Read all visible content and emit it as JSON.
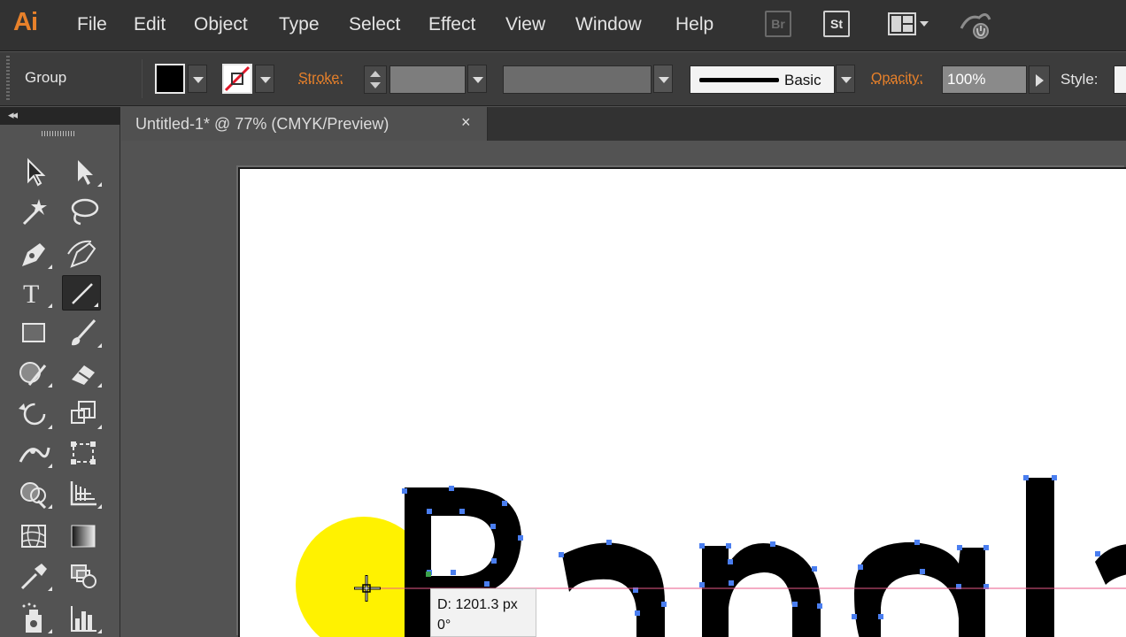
{
  "app": {
    "logo": "Ai"
  },
  "menu": [
    "File",
    "Edit",
    "Object",
    "Type",
    "Select",
    "Effect",
    "View",
    "Window",
    "Help"
  ],
  "menubar_icons": {
    "bridge": "Br",
    "stock": "St",
    "workspace": "workspace-switcher-icon",
    "sync": "sync-settings-icon"
  },
  "control_bar": {
    "selection": "Group",
    "fill_color": "#000000",
    "stroke_color": "none",
    "stroke_label": "Stroke:",
    "brush_label": "Basic",
    "opacity_label": "Opacity:",
    "opacity_value": "100%",
    "style_label": "Style:"
  },
  "tools_panel": {
    "collapse": "◂◂",
    "tools": [
      "selection-tool-icon",
      "direct-selection-tool-icon",
      "magic-wand-tool-icon",
      "lasso-tool-icon",
      "pen-tool-icon",
      "curvature-tool-icon",
      "type-tool-icon",
      "line-segment-tool-icon",
      "rectangle-tool-icon",
      "paintbrush-tool-icon",
      "shaper-tool-icon",
      "eraser-tool-icon",
      "rotate-tool-icon",
      "scale-tool-icon",
      "width-tool-icon",
      "free-transform-tool-icon",
      "shape-builder-tool-icon",
      "perspective-grid-tool-icon",
      "mesh-tool-icon",
      "gradient-tool-icon",
      "eyedropper-tool-icon",
      "blend-tool-icon",
      "symbol-sprayer-tool-icon",
      "column-graph-tool-icon"
    ],
    "selected_tool": "line-segment-tool-icon"
  },
  "document": {
    "tab_title": "Untitled-1* @ 77% (CMYK/Preview)",
    "close": "×"
  },
  "artwork": {
    "text": "Bangla",
    "text_color": "#000000",
    "anchor_color": "#4a7ef0",
    "cursor_highlight": "#fff200"
  },
  "measure": {
    "distance": "D: 1201.3 px",
    "angle": "0°"
  }
}
